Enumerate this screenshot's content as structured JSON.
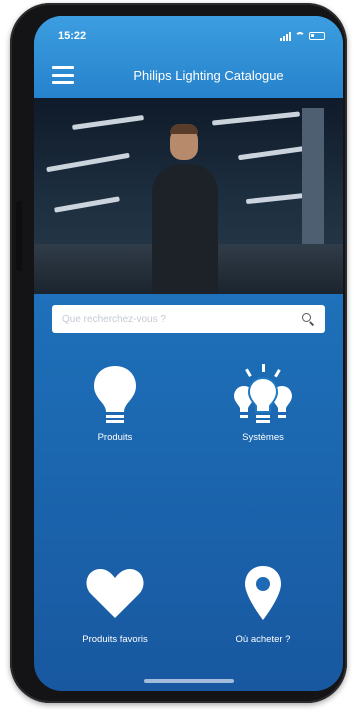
{
  "status": {
    "time": "15:22"
  },
  "header": {
    "title": "Philips Lighting Catalogue"
  },
  "search": {
    "placeholder": "Que recherchez-vous ?"
  },
  "tiles": [
    {
      "label": "Produits",
      "icon": "lightbulb-icon"
    },
    {
      "label": "Systèmes",
      "icon": "lightbulbs-system-icon"
    },
    {
      "label": "Produits favoris",
      "icon": "heart-icon"
    },
    {
      "label": "Où acheter ?",
      "icon": "location-pin-icon"
    }
  ],
  "colors": {
    "primary": "#2682cc",
    "background_dark": "#1858a0",
    "white": "#ffffff"
  }
}
